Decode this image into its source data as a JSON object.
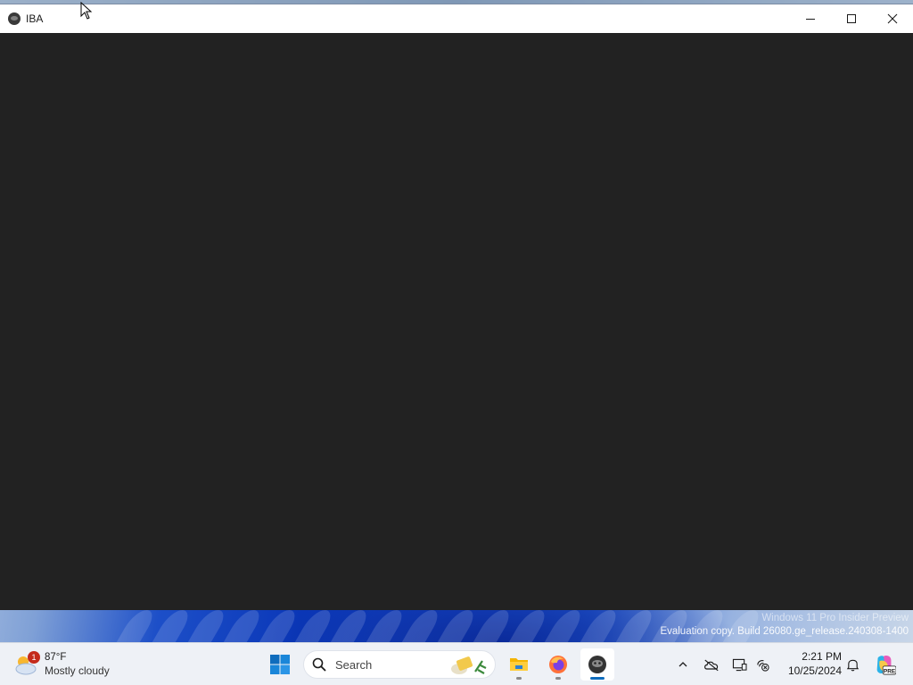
{
  "window": {
    "title": "IBA",
    "icon": "iba-app-icon",
    "controls": {
      "minimize_icon": "minimize-icon",
      "maximize_icon": "maximize-icon",
      "close_icon": "close-icon"
    },
    "content_bg": "#222222"
  },
  "watermark": {
    "line1": "Windows 11 Pro Insider Preview",
    "line2": "Evaluation copy. Build 26080.ge_release.240308-1400"
  },
  "taskbar": {
    "weather": {
      "temp": "87°F",
      "condition": "Mostly cloudy",
      "badge": "1",
      "icon": "partly-cloudy-icon"
    },
    "start_icon": "windows-start-icon",
    "search": {
      "placeholder": "Search",
      "icon": "search-icon"
    },
    "apps": [
      {
        "name": "File Explorer",
        "icon": "file-explorer-icon",
        "active": false
      },
      {
        "name": "Firefox",
        "icon": "firefox-icon",
        "active": false
      },
      {
        "name": "IBA",
        "icon": "iba-app-icon",
        "active": true
      }
    ],
    "tray": {
      "chevron_icon": "chevron-up-icon",
      "onedrive_icon": "onedrive-offline-icon",
      "display_icon": "display-icon",
      "network_icon": "network-disconnected-icon",
      "time": "2:21 PM",
      "date": "10/25/2024",
      "notifications_icon": "bell-icon",
      "copilot_icon": "copilot-pre-icon"
    }
  },
  "colors": {
    "accent": "#0f6cbd",
    "badge": "#c42b1c",
    "taskbar_bg": "#eef1f6"
  }
}
